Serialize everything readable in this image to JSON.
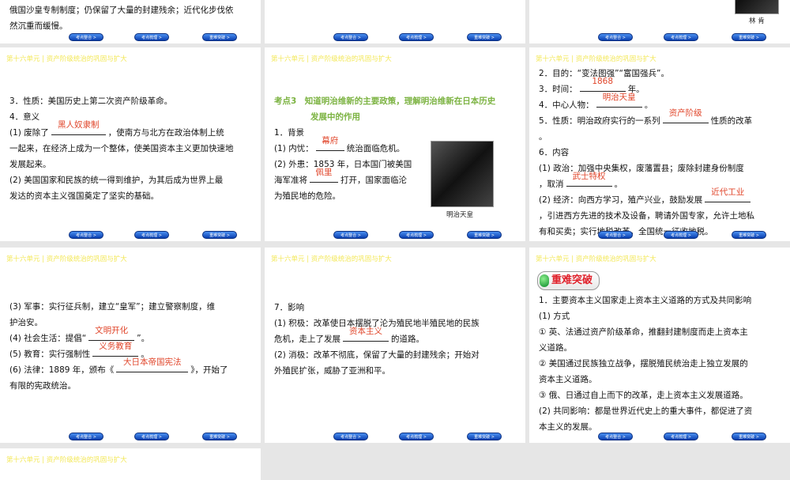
{
  "header": "第十六单元 | 资产阶级统治的巩固与扩大",
  "nav": [
    "考点整合 >",
    "考点梳理 >",
    "重难突破 >"
  ],
  "slides": [
    {
      "cls": "c0 r0",
      "bodyTop": "203px",
      "lines": [
        [
          {
            "t": "俄国沙皇专制制度；仍保留了大量的封建残余；近代化步伐依"
          }
        ],
        [
          {
            "t": "然沉重而缓慢。"
          }
        ]
      ]
    },
    {
      "cls": "c1 r0",
      "lines": []
    },
    {
      "cls": "c2 r0",
      "lines": [],
      "photo": "lincoln",
      "caption": "林 肯"
    },
    {
      "cls": "c0 r1",
      "header": true,
      "bodyTop": "58px",
      "lines": [
        [
          {
            "t": "3．性质：美国历史上第二次资产阶级革命。"
          }
        ],
        [
          {
            "t": "4．意义"
          }
        ],
        [
          {
            "t": "(1) 废除了"
          },
          {
            "a": "黑人奴隶制"
          },
          {
            "t": "，使南方与北方在政治体制上统"
          }
        ],
        [
          {
            "t": "一起来，在经济上成为一个整体，使美国资本主义更加快速地"
          }
        ],
        [
          {
            "t": "发展起来。"
          }
        ],
        [
          {
            "t": "(2) 美国国家和民族的统一得到维护，为其后成为世界上最"
          }
        ],
        [
          {
            "t": "发达的资本主义强国奠定了坚实的基础。"
          }
        ]
      ]
    },
    {
      "cls": "c1 r1",
      "header": true,
      "bodyTop": "58px",
      "heading": [
        "考点3　知道明治维新的主要政策，理解明治维新在日本历史",
        "发展中的作用"
      ],
      "lines": [
        [
          {
            "t": "1．背景"
          }
        ],
        [
          {
            "t": "(1) 内忧："
          },
          {
            "a": "幕府"
          },
          {
            "t": "统治面临危机。"
          }
        ],
        [
          {
            "t": "(2) 外患：1853 年，日本国门被美国"
          }
        ],
        [
          {
            "t": "海军准将"
          },
          {
            "a": "佩里"
          },
          {
            "t": "打开，国家面临沦"
          }
        ],
        [
          {
            "t": "为殖民地的危险。"
          }
        ]
      ],
      "photo": "meiji",
      "caption": "明治天皇"
    },
    {
      "cls": "c2 r1",
      "header": true,
      "bodyTop": "23px",
      "lines": [
        [
          {
            "t": "2．目的：“变法图强”“富国强兵”。"
          }
        ],
        [
          {
            "t": "3．时间："
          },
          {
            "a": "1868"
          },
          {
            "t": "年。"
          }
        ],
        [
          {
            "t": "4．中心人物："
          },
          {
            "a": "明治天皇"
          },
          {
            "t": "。"
          }
        ],
        [
          {
            "t": "5．性质：明治政府实行的一系列"
          },
          {
            "a": "资产阶级"
          },
          {
            "t": "性质的改革"
          }
        ],
        [
          {
            "t": "。"
          }
        ],
        [
          {
            "t": "6．内容"
          }
        ],
        [
          {
            "t": "(1) 政治：加强中央集权，废藩置县；废除封建身份制度"
          }
        ],
        [
          {
            "t": "，取消"
          },
          {
            "a": "武士特权"
          },
          {
            "t": "。"
          }
        ],
        [
          {
            "t": "(2) 经济：向西方学习，殖产兴业，鼓励发展"
          },
          {
            "a": "近代工业"
          }
        ],
        [
          {
            "t": "，引进西方先进的技术及设备，聘请外国专家，允许土地私"
          }
        ],
        [
          {
            "t": "有和买卖；实行地税改革，全国统一征收地税。"
          }
        ]
      ]
    },
    {
      "cls": "c0 r2",
      "header": true,
      "bodyTop": "65px",
      "lines": [
        [
          {
            "t": "(3) 军事：实行征兵制，建立“皇军”；建立警察制度，维"
          }
        ],
        [
          {
            "t": "护治安。"
          }
        ],
        [
          {
            "t": "(4) 社会生活：提倡“"
          },
          {
            "a": "文明开化"
          },
          {
            "t": "”。"
          }
        ],
        [
          {
            "t": "(5) 教育：实行强制性"
          },
          {
            "a": "义务教育"
          },
          {
            "t": "。"
          }
        ],
        [
          {
            "t": "(6) 法律：1889 年，颁布《"
          },
          {
            "a": "大日本帝国宪法"
          },
          {
            "t": "》，开始了"
          }
        ],
        [
          {
            "t": "有限的宪政统治。"
          }
        ]
      ]
    },
    {
      "cls": "c1 r2",
      "header": true,
      "bodyTop": "66px",
      "lines": [
        [
          {
            "t": "7．影响"
          }
        ],
        [
          {
            "t": "(1) 积极：改革使日本摆脱了沦为殖民地半殖民地的民族"
          }
        ],
        [
          {
            "t": "危机，走上了发展"
          },
          {
            "a": "资本主义"
          },
          {
            "t": "的道路。"
          }
        ],
        [
          {
            "t": "(2) 消极：改革不彻底，保留了大量的封建残余；开始对"
          }
        ],
        [
          {
            "t": "外殖民扩张，威胁了亚洲和平。"
          }
        ]
      ]
    },
    {
      "cls": "c2 r2",
      "header": true,
      "bodyTop": "30px",
      "badge": "重难突破",
      "lines": [
        [
          {
            "t": "1．主要资本主义国家走上资本主义道路的方式及共同影响"
          }
        ],
        [
          {
            "t": "(1) 方式"
          }
        ],
        [
          {
            "t": "① 英、法通过资产阶级革命，推翻封建制度而走上资本主"
          }
        ],
        [
          {
            "t": "义道路。"
          }
        ],
        [
          {
            "t": "② 美国通过民族独立战争，摆脱殖民统治走上独立发展的"
          }
        ],
        [
          {
            "t": "资本主义道路。"
          }
        ],
        [
          {
            "t": "③ 俄、日通过自上而下的改革，走上资本主义发展道路。"
          }
        ],
        [
          {
            "t": "(2) 共同影响：都是世界近代史上的重大事件，都促进了资"
          }
        ],
        [
          {
            "t": "本主义的发展。"
          }
        ]
      ]
    },
    {
      "cls": "c0 r3",
      "header": true,
      "nonav": true,
      "lines": []
    }
  ]
}
